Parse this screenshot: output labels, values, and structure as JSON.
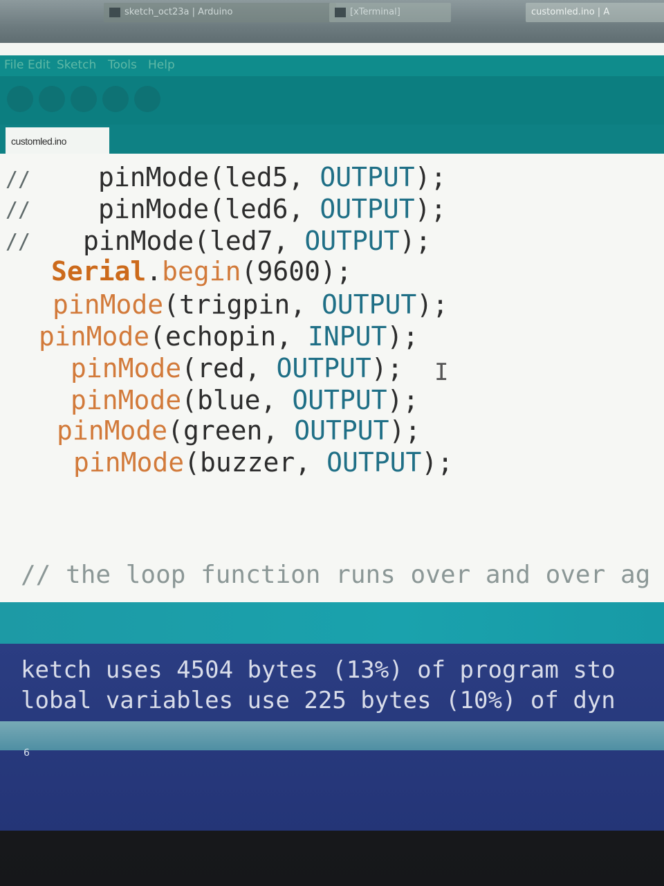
{
  "taskbar": {
    "arduino_window": "sketch_oct23a | Arduino",
    "terminal_window": "[xTerminal]",
    "customled_window": "customled.ino | A"
  },
  "menubar": {
    "items": [
      "File",
      "Edit",
      "Sketch",
      "Tools",
      "Help"
    ]
  },
  "editor": {
    "tab_name": "customled.ino",
    "gutter_marks": [
      "//",
      "//",
      "//"
    ],
    "lines": [
      {
        "fn": "pinMode",
        "open": "(",
        "arg": "led5",
        "sep": ", ",
        "mode": "OUTPUT",
        "close": ");"
      },
      {
        "fn": "pinMode",
        "open": "(",
        "arg": "led6",
        "sep": ", ",
        "mode": "OUTPUT",
        "close": ");"
      },
      {
        "fn": "pinMode",
        "open": "(",
        "arg": "led7",
        "sep": ", ",
        "mode": "OUTPUT",
        "close": ");"
      },
      {
        "fn": "Serial",
        "dot": ".",
        "method": "begin",
        "open": "(",
        "arg": "9600",
        "close": ");"
      },
      {
        "fn": "pinMode",
        "open": "(",
        "arg": "trigpin",
        "sep": ", ",
        "mode": "OUTPUT",
        "close": ");"
      },
      {
        "fn": "pinMode",
        "open": "(",
        "arg": "echopin",
        "sep": ", ",
        "mode": "INPUT",
        "close": ");"
      },
      {
        "fn": "pinMode",
        "open": "(",
        "arg": "red",
        "sep": ", ",
        "mode": "OUTPUT",
        "close": ");"
      },
      {
        "fn": "pinMode",
        "open": "(",
        "arg": "blue",
        "sep": ", ",
        "mode": "OUTPUT",
        "close": ");"
      },
      {
        "fn": "pinMode",
        "open": "(",
        "arg": "green",
        "sep": ", ",
        "mode": "OUTPUT",
        "close": ");"
      },
      {
        "fn": "pinMode",
        "open": "(",
        "arg": "buzzer",
        "sep": ", ",
        "mode": "OUTPUT",
        "close": ");"
      }
    ],
    "text_cursor": "I",
    "comment": "// the loop function runs over and over ag"
  },
  "console": {
    "line1": "ketch uses 4504 bytes (13%) of program sto",
    "line2": "lobal variables use 225 bytes (10%) of dyn"
  },
  "status": {
    "line_number": "6"
  },
  "colors": {
    "menubar": "#0f8c8c",
    "console_bg": "#2b3d82",
    "divider": "#1d9aa5",
    "keyword_orange": "#d27a3a",
    "constant_blue": "#1f6f86"
  }
}
